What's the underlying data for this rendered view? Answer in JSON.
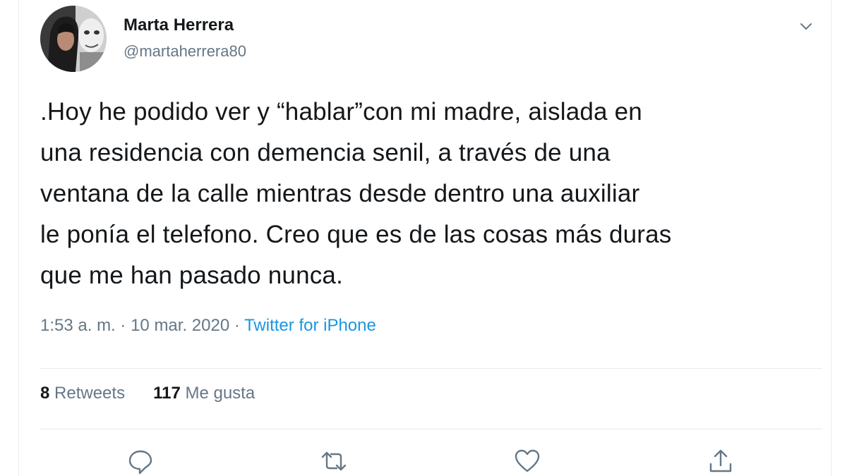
{
  "user": {
    "display_name": "Marta Herrera",
    "handle": "@martaherrera80"
  },
  "tweet": {
    "lines": [
      ".Hoy he podido ver y “hablar”con mi madre, aislada en",
      "una residencia con demencia senil, a través de una",
      "ventana de la calle mientras desde dentro una auxiliar",
      "le ponía el telefono. Creo que es de las cosas más duras",
      "que me han pasado nunca."
    ],
    "time": "1:53 a. m.",
    "date": "10 mar. 2020",
    "separator": "·",
    "source": "Twitter for iPhone"
  },
  "stats": {
    "retweets_count": "8",
    "retweets_label": "Retweets",
    "likes_count": "117",
    "likes_label": "Me gusta"
  },
  "icons": {
    "caret": "chevron-down-icon",
    "reply": "reply-icon",
    "retweet": "retweet-icon",
    "like": "heart-icon",
    "share": "share-icon"
  },
  "colors": {
    "text": "#14171a",
    "secondary": "#657786",
    "link": "#1b95e0",
    "divider": "#e6ecf0"
  }
}
